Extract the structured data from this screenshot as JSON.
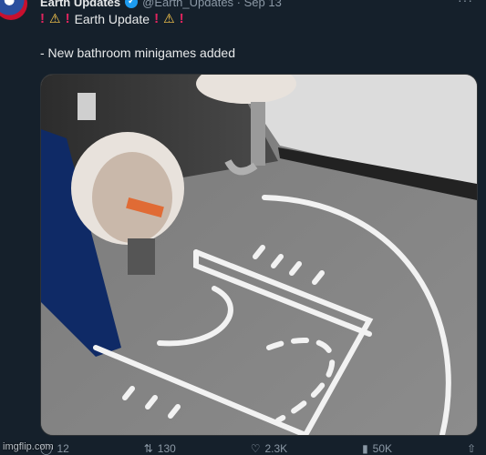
{
  "tweet": {
    "author_name": "Earth Updates",
    "handle_time": "@Earth_Updates · Sep 13",
    "headline": "Earth Update",
    "body": "- New bathroom minigames added"
  },
  "icons": {
    "avatar": "globe-avatar-icon",
    "verified": "verified-badge-icon",
    "exclaim": "red-exclamation-icon",
    "warning": "warning-sign-icon",
    "more": "more-options-icon",
    "reply": "reply-icon",
    "retweet": "retweet-icon",
    "like": "heart-icon",
    "views": "views-chart-icon",
    "share": "share-icon"
  },
  "actions": {
    "replies": "12",
    "retweets": "130",
    "likes": "2.3K",
    "views": "50K"
  },
  "watermark": "imgflip.com",
  "colors": {
    "background": "#15202b",
    "verified": "#1d9bf0",
    "exclaim": "#e0245e",
    "warning": "#ffcc4d"
  }
}
